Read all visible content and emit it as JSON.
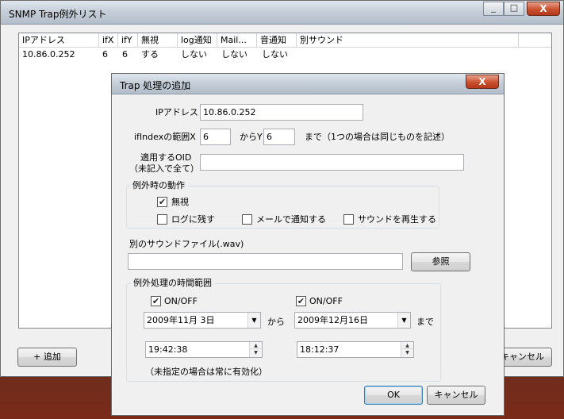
{
  "main_window": {
    "title": "SNMP Trap例外リスト",
    "close_glyph": "X",
    "minimize_glyph": "_",
    "maximize_glyph": "□",
    "columns": [
      "IPアドレス",
      "ifX",
      "ifY",
      "無視",
      "log通知",
      "Mail...",
      "音通知",
      "別サウンド"
    ],
    "rows": [
      [
        "10.86.0.252",
        "6",
        "6",
        "する",
        "しない",
        "しない",
        "しない",
        ""
      ]
    ],
    "add_button": "+ 追加",
    "cancel_button": "キャンセル"
  },
  "dialog": {
    "title": "Trap 処理の追加",
    "close_glyph": "X",
    "ip_label": "IPアドレス",
    "ip_value": "10.86.0.252",
    "ifindex_label": "ifIndexの範囲X",
    "ifx_value": "6",
    "kara_y_label": "からY",
    "ify_value": "6",
    "made_hint": "まで（1つの場合は同じものを記述）",
    "oid_label_1": "適用するOID",
    "oid_label_2": "（未記入で全て）",
    "oid_value": "",
    "action_group": "例外時の動作",
    "ignore_label": "無視",
    "log_label": "ログに残す",
    "mail_label": "メールで通知する",
    "sound_label": "サウンドを再生する",
    "check_mark": "✔",
    "sound_file_label": "別のサウンドファイル(.wav)",
    "sound_file_value": "",
    "browse_button": "参照",
    "time_group": "例外処理の時間範囲",
    "onoff_label_1": "ON/OFF",
    "onoff_label_2": "ON/OFF",
    "start_date": "2009年11月  3日",
    "kara_label": "から",
    "end_date": "2009年12月16日",
    "made_label": "まで",
    "start_time": "19:42:38",
    "end_time": "18:12:37",
    "note": "（未指定の場合は常に有効化）",
    "ok_button": "OK",
    "cancel_button": "キャンセル"
  }
}
